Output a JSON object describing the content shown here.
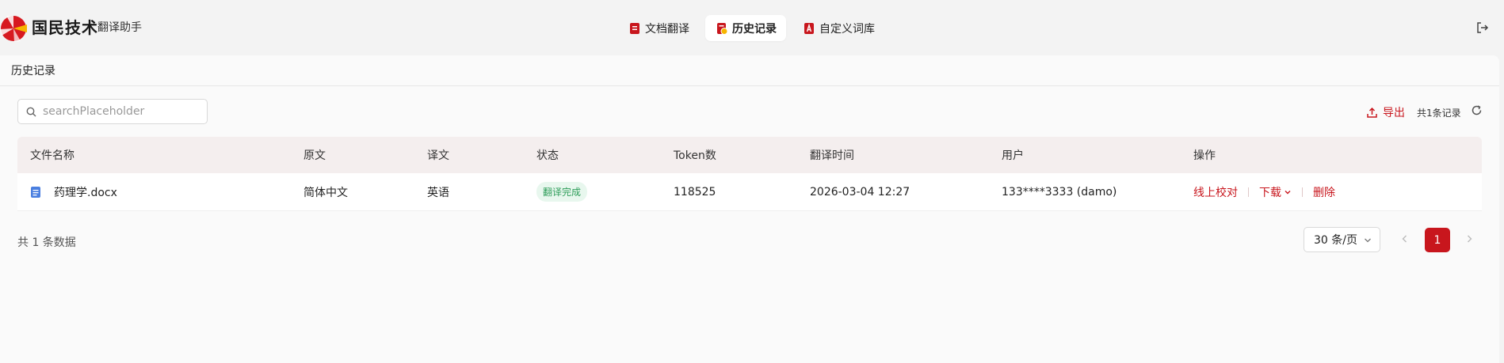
{
  "brand": {
    "name": "国民技术",
    "subtitle": "翻译助手"
  },
  "nav": {
    "tabs": [
      {
        "label": "文档翻译",
        "active": false
      },
      {
        "label": "历史记录",
        "active": true
      },
      {
        "label": "自定义词库",
        "active": false
      }
    ]
  },
  "page": {
    "title": "历史记录"
  },
  "search": {
    "placeholder": "searchPlaceholder",
    "value": ""
  },
  "toolbar": {
    "export_label": "导出",
    "record_count": "共1条记录"
  },
  "table": {
    "headers": [
      "文件名称",
      "原文",
      "译文",
      "状态",
      "Token数",
      "翻译时间",
      "用户",
      "操作"
    ],
    "rows": [
      {
        "file": "药理学.docx",
        "source": "简体中文",
        "target": "英语",
        "status": "翻译完成",
        "tokens": "118525",
        "time": "2026-03-04 12:27",
        "user": "133****3333 (damo)",
        "actions": {
          "proofread": "线上校对",
          "download": "下载",
          "delete": "删除"
        }
      }
    ]
  },
  "pagination": {
    "total_text": "共 1 条数据",
    "page_size": "30 条/页",
    "current_page": "1"
  },
  "colors": {
    "accent": "#c8161d",
    "success": "#2f9e5a",
    "header_bg": "#f4eeee"
  },
  "icons": [
    "logo-icon",
    "doc-translate-icon",
    "history-icon",
    "dictionary-icon",
    "logout-icon",
    "search-icon",
    "export-icon",
    "refresh-icon",
    "word-file-icon",
    "chevron-down-icon",
    "chevron-left-icon",
    "chevron-right-icon"
  ]
}
